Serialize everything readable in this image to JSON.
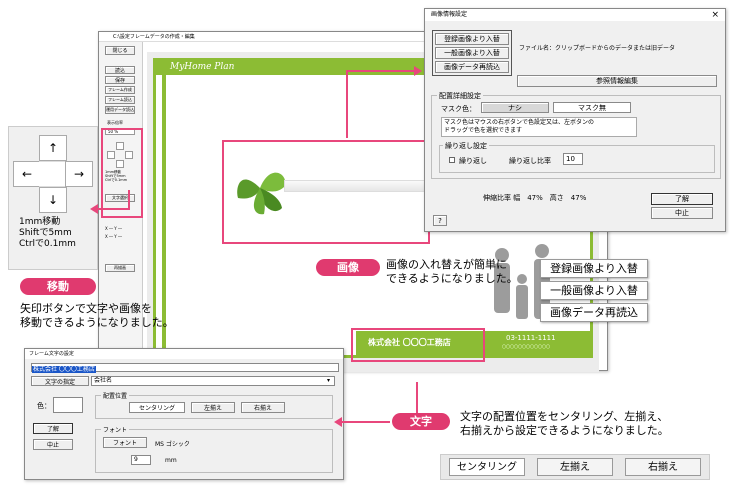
{
  "main_window": {
    "title": "C:\\設定フレームデータの作成・編集",
    "side_buttons": [
      "閉じる",
      "読込",
      "保存",
      "フレーム作成",
      "フレーム読込",
      "運用データ読込",
      "表示倍率",
      "文字選択"
    ],
    "zoom": "50 %",
    "clear_button": "再描画",
    "move_note": "1mm移動\nShiftで5mm\nCtrlで0.1mm",
    "coord_x": "X ― Y ―",
    "coord_y": "X ― Y ―",
    "plan_title": "MyHome Plan",
    "company_name": "株式会社 〇〇〇工務店",
    "phone": "03-1111-1111",
    "sub_text": "〇〇〇〇〇〇〇〇〇〇〇〇"
  },
  "image_dialog": {
    "title": "画像情報設定",
    "btn_register": "登録画像より入替",
    "btn_general": "一般画像より入替",
    "btn_reload": "画像データ再読込",
    "filename": "ファイル名：クリップボードからのデータまたは旧データ",
    "btn_ref_edit": "参照情報編集",
    "group_layout": "配置詳細設定",
    "mask_color_label": "マスク色：",
    "mask_none": "ナシ",
    "mask_black": "マスク無",
    "mask_note": "マスク色はマウスの右ボタンで色設定又は、左ボタンの\nドラッグで色を選択できます",
    "group_repeat": "繰り返し設定",
    "repeat_checkbox": "繰り返し",
    "repeat_ratio_label": "繰り返し比率",
    "repeat_ratio_value": "10",
    "ratio_text": "伸縮比率 幅　47%　高さ　47%",
    "ok": "了解",
    "cancel": "中止",
    "help": "?"
  },
  "text_dialog": {
    "title": "フレーム文字の設定",
    "text_value": "株式会社 〇〇〇工務店",
    "text_spec_label": "文字の指定",
    "text_spec_value": "会社名",
    "color_label": "色：",
    "group_position": "配置位置",
    "center": "センタリング",
    "left": "左揃え",
    "right": "右揃え",
    "ok": "了解",
    "cancel": "中止",
    "group_font": "フォント",
    "font_button": "フォント",
    "font_name": "MS ゴシック",
    "font_size": "9",
    "unit": "mm"
  },
  "annotations": {
    "move_icon_caption": "1mm移動\nShiftで5mm\nCtrlで0.1mm",
    "move_tag": "移動",
    "move_desc": "矢印ボタンで文字や画像を\n移動できるようになりました。",
    "image_tag": "画像",
    "image_desc": "画像の入れ替えが簡単に\nできるようになりました。",
    "btn_register": "登録画像より入替",
    "btn_general": "一般画像より入替",
    "btn_reload": "画像データ再読込",
    "text_tag": "文字",
    "text_desc": "文字の配置位置をセンタリング、左揃え、\n右揃えから設定できるようになりました。",
    "pos_center": "センタリング",
    "pos_left": "左揃え",
    "pos_right": "右揃え"
  },
  "colors": {
    "accent": "#e03a6f",
    "green": "#8cbc34",
    "dark_green": "#6a9a1e"
  }
}
